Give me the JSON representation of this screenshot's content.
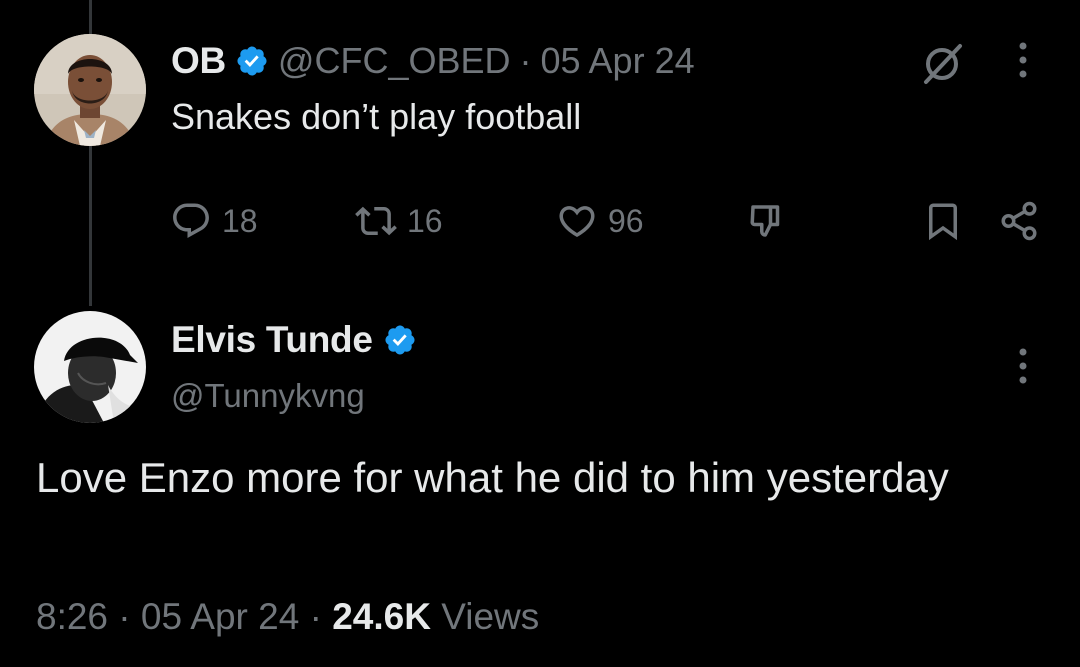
{
  "parent_tweet": {
    "author_name": "OB",
    "handle": "@CFC_OBED",
    "separator": "·",
    "date": "05 Apr 24",
    "text": "Snakes don’t play football",
    "replies": "18",
    "retweets": "16",
    "likes": "96",
    "avatar_icon": "man-portrait-avatar",
    "verified_icon": "verified-badge-icon"
  },
  "reply_tweet": {
    "author_name": "Elvis Tunde",
    "handle": "@Tunnykvng",
    "text": "Love Enzo more for what he did to him yesterday",
    "time": "8:26",
    "dot1": "·",
    "date": "05 Apr 24",
    "dot2": "·",
    "views_count": "24.6K",
    "views_label": "Views",
    "avatar_icon": "black-white-cap-portrait-avatar",
    "verified_icon": "verified-badge-icon"
  },
  "colors": {
    "background": "#000000",
    "primary_text": "#e7e9ea",
    "secondary_text": "#71767b",
    "verified_blue": "#1d9bf0",
    "thread_line": "#333639"
  }
}
